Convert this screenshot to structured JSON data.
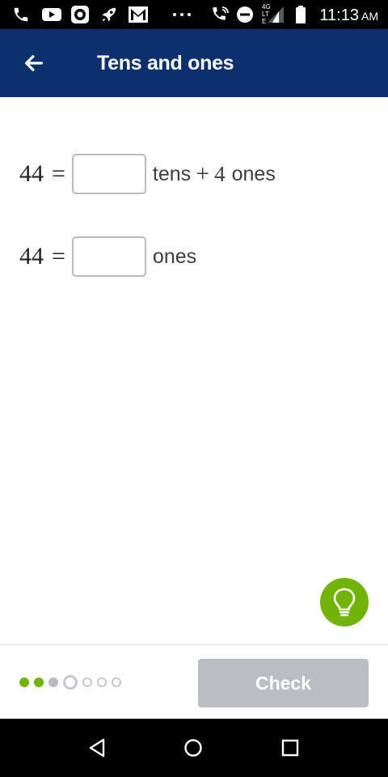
{
  "status_bar": {
    "time": "11:13",
    "ampm": "AM",
    "network": "4G LTE",
    "icons": [
      "phone-icon",
      "youtube-icon",
      "app-icon",
      "rocket-icon",
      "gmail-icon",
      "more-dots-icon",
      "wifi-call-icon",
      "do-not-disturb-icon",
      "signal-icon",
      "battery-icon"
    ]
  },
  "header": {
    "title": "Tens and ones",
    "back_icon": "arrow-left-icon",
    "background": "#0c2f6e"
  },
  "exercise": {
    "row1": {
      "lhs": "44",
      "equals": "=",
      "input_value": "",
      "text_after": "tens",
      "plus": "+",
      "digit": "4",
      "text_end": "ones"
    },
    "row2": {
      "lhs": "44",
      "equals": "=",
      "input_value": "",
      "text_after": "ones"
    }
  },
  "hint": {
    "icon": "lightbulb-icon",
    "color": "#71b307"
  },
  "footer": {
    "progress": {
      "total": 7,
      "completed": 2,
      "current_index": 3,
      "states": [
        "done",
        "done",
        "seen",
        "current",
        "todo",
        "todo",
        "todo"
      ]
    },
    "check_label": "Check"
  },
  "nav": {
    "icons": [
      "back-triangle-icon",
      "home-circle-icon",
      "recents-square-icon"
    ]
  }
}
